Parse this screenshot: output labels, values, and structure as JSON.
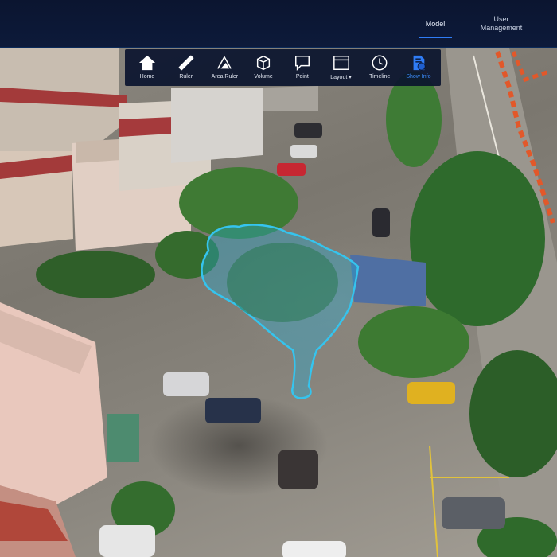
{
  "header": {
    "tabs": [
      {
        "label": "Model",
        "active": true
      },
      {
        "label": "User\nManagement",
        "active": false
      }
    ]
  },
  "toolbar": {
    "tools": [
      {
        "label": "Home",
        "icon": "home-icon"
      },
      {
        "label": "Ruler",
        "icon": "ruler-icon"
      },
      {
        "label": "Area Ruler",
        "icon": "area-ruler-icon"
      },
      {
        "label": "Volume",
        "icon": "cube-icon"
      },
      {
        "label": "Point",
        "icon": "point-comment-icon"
      },
      {
        "label": "Layout ▾",
        "icon": "layout-icon"
      },
      {
        "label": "Timeline",
        "icon": "clock-icon"
      },
      {
        "label": "Show Info",
        "icon": "info-document-icon",
        "active": true
      }
    ]
  },
  "colors": {
    "header_bg": "#0b1530",
    "accent": "#2f7cf6",
    "selection_outline": "#35c4ee"
  }
}
